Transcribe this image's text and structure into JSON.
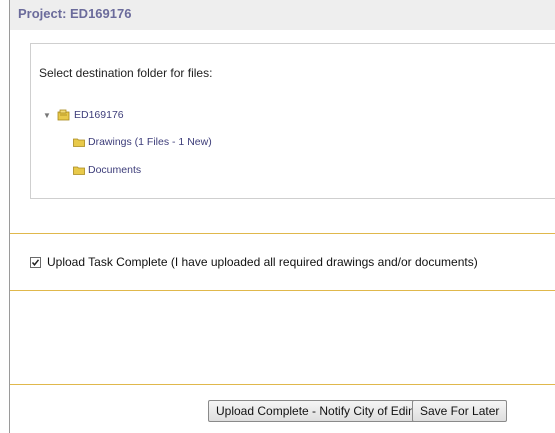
{
  "project": {
    "title": "Project: ED169176"
  },
  "panel": {
    "prompt": "Select destination folder for files:",
    "tree": {
      "root_label": "ED169176",
      "children": [
        {
          "label": "Drawings (1 Files - 1 New)"
        },
        {
          "label": "Documents"
        }
      ]
    }
  },
  "upload_task": {
    "checked": true,
    "label": "Upload Task Complete (I have uploaded all required drawings and/or documents)"
  },
  "buttons": {
    "complete_label": "Upload Complete - Notify City of Edina",
    "save_label": "Save For Later"
  },
  "colors": {
    "divider": "#e0b84c",
    "folder": "#e8c94a",
    "link": "#3d3d7a",
    "title": "#6b6b9b"
  }
}
